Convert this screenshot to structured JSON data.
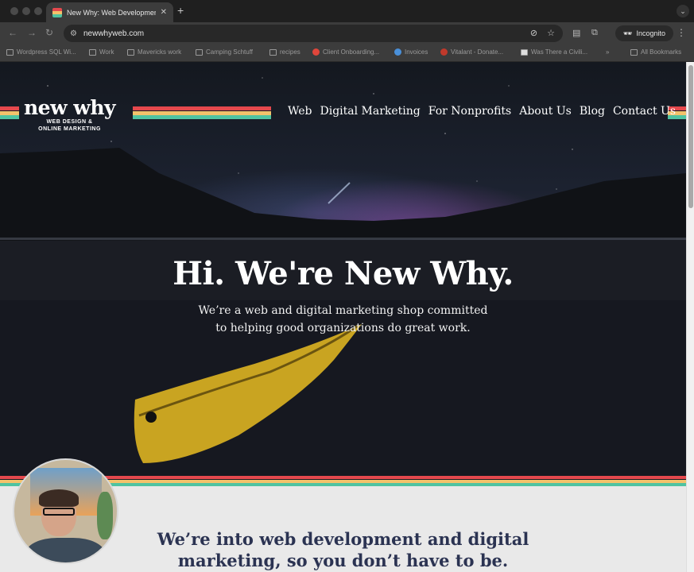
{
  "browser": {
    "tab_title": "New Why: Web Development",
    "tab_close": "✕",
    "new_tab": "+",
    "url": "newwhyweb.com",
    "profile": "Incognito",
    "bookmarks": [
      "Wordpress SQL Wi...",
      "Work",
      "Mavericks work",
      "Camping Schtuff",
      "recipes",
      "Client Onboarding...",
      "Invoices",
      "Vitalant - Donate...",
      "Was There a Civili...",
      "All Bookmarks"
    ],
    "more_bookmarks": "»"
  },
  "site": {
    "logo_name": "new why",
    "logo_tag_line1": "WEB DESIGN &",
    "logo_tag_line2": "ONLINE MARKETING",
    "nav": [
      "Web",
      "Digital Marketing",
      "For Nonprofits",
      "About Us",
      "Blog",
      "Contact Us"
    ],
    "headline": "Hi. We're New Why.",
    "subline1": "We’re a web and digital marketing shop committed",
    "subline2": "to helping good organizations do great work.",
    "section_line1": "We’re into web development and digital",
    "section_line2": "marketing, so you don’t have to be."
  },
  "colors": {
    "stripe_red": "#e5484d",
    "stripe_yellow": "#f3c26b",
    "stripe_teal": "#4fc3a1",
    "heading_navy": "#2b3352"
  }
}
